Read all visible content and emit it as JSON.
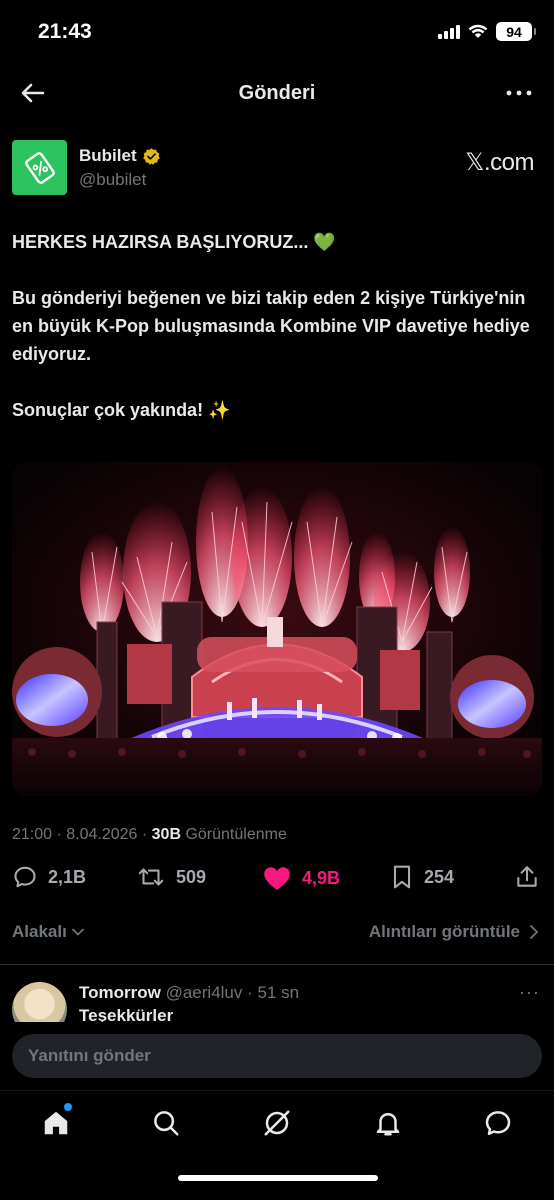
{
  "status_bar": {
    "time": "21:43",
    "battery": "94"
  },
  "header": {
    "title": "Gönderi"
  },
  "author": {
    "name": "Bubilet",
    "handle": "@bubilet",
    "source": "𝕏.com"
  },
  "tweet": {
    "line1": "HERKES HAZIRSA BAŞLIYORUZ... 💚",
    "line2": "Bu gönderiyi beğenen ve bizi takip eden 2 kişiye Türkiye'nin en büyük K-Pop buluşmasında Kombine VIP davetiye hediye ediyoruz.",
    "line3": "Sonuçlar çok yakında! ✨"
  },
  "meta": {
    "time_date": "21:00 · 8.04.2026 · ",
    "views": "30B",
    "views_label": " Görüntülenme"
  },
  "actions": {
    "replies": "2,1B",
    "reposts": "509",
    "likes": "4,9B",
    "bookmarks": "254"
  },
  "relevance": {
    "sort": "Alakalı",
    "quotes": "Alıntıları görüntüle"
  },
  "reply": {
    "name": "Tomorrow",
    "handle": "@aeri4luv",
    "time": " · 51 sn",
    "more": "···",
    "text": "Teşekkürler"
  },
  "reply_input": {
    "placeholder": "Yanıtını gönder"
  },
  "colors": {
    "accent": "#1d9bf0",
    "like": "#f91880",
    "verified": "#e2b719",
    "brand": "#2cc35f"
  }
}
